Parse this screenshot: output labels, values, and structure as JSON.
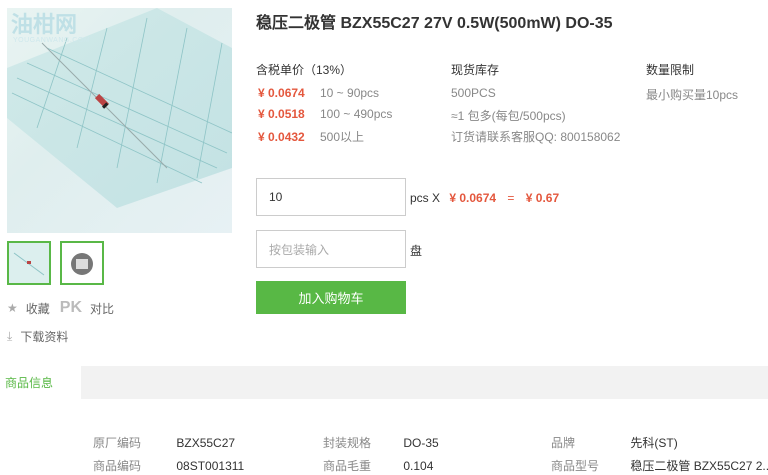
{
  "watermark": {
    "logo": "油柑网",
    "sub": "YOUGANWANG.COM"
  },
  "product": {
    "title": "稳压二极管 BZX55C27 27V 0.5W(500mW) DO-35"
  },
  "sidebar": {
    "favorite_label": "收藏",
    "pk_label": "PK",
    "compare_label": "对比",
    "download_label": "下载资料"
  },
  "pricing": {
    "header": "含税单价（13%）",
    "tiers": [
      {
        "price": "¥ 0.0674",
        "qty": "10 ~ 90pcs"
      },
      {
        "price": "¥ 0.0518",
        "qty": "100 ~ 490pcs"
      },
      {
        "price": "¥ 0.0432",
        "qty": "500以上"
      }
    ]
  },
  "stock": {
    "header": "现货库存",
    "amount": "500PCS",
    "package": "≈1 包多(每包/500pcs)",
    "contact": "订货请联系客服QQ: 800158062"
  },
  "limit": {
    "header": "数量限制",
    "text": "最小购买量10pcs"
  },
  "order": {
    "qty_value": "10",
    "unit": "pcs X",
    "unit_price": "¥ 0.0674",
    "equals": "=",
    "total": "¥ 0.67",
    "pkg_placeholder": "按包装输入",
    "pkg_unit": "盘",
    "add_to_cart": "加入购物车"
  },
  "tabs": {
    "active": "商品信息"
  },
  "specs": [
    {
      "k": "原厂编码",
      "v": "BZX55C27"
    },
    {
      "k": "封装规格",
      "v": "DO-35"
    },
    {
      "k": "品牌",
      "v": "先科(ST)"
    },
    {
      "k": "商品编码",
      "v": "08ST001311"
    },
    {
      "k": "商品毛重",
      "v": "0.104"
    },
    {
      "k": "商品型号",
      "v": "稳压二极管 BZX55C27 2..."
    }
  ],
  "colors": {
    "accent": "#58b845",
    "price": "#e4573d"
  }
}
